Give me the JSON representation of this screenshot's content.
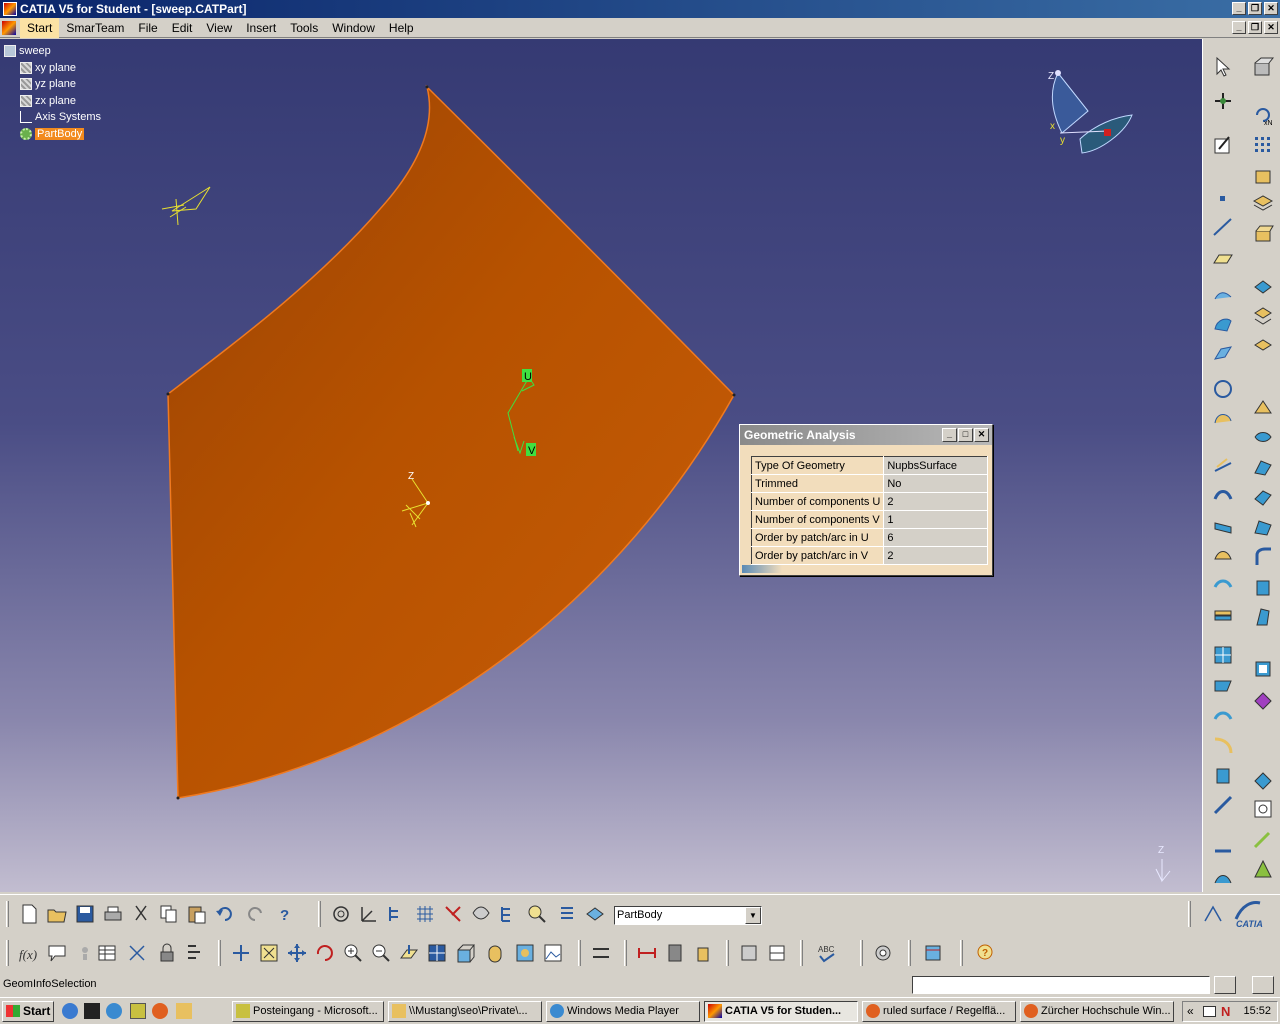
{
  "window": {
    "title": "CATIA V5 for Student - [sweep.CATPart]"
  },
  "menu": [
    "Start",
    "SmarTeam",
    "File",
    "Edit",
    "View",
    "Insert",
    "Tools",
    "Window",
    "Help"
  ],
  "tree": {
    "root": "sweep",
    "items": [
      "xy plane",
      "yz plane",
      "zx plane",
      "Axis Systems",
      "PartBody"
    ]
  },
  "viewport": {
    "axis_labels": {
      "u": "U",
      "v": "V",
      "z": "Z",
      "x": "x",
      "y": "y"
    }
  },
  "dialog": {
    "title": "Geometric Analysis",
    "rows": [
      {
        "label": "Type Of Geometry",
        "value": "NupbsSurface"
      },
      {
        "label": "Trimmed",
        "value": "No"
      },
      {
        "label": "Number of components U",
        "value": "2"
      },
      {
        "label": "Number of components V",
        "value": "1"
      },
      {
        "label": "Order by patch/arc in U",
        "value": "6"
      },
      {
        "label": "Order by patch/arc in V",
        "value": "2"
      }
    ]
  },
  "toolbar": {
    "body_select": "PartBody",
    "fx": "f(x)",
    "abc": "ABC"
  },
  "brand": {
    "logo": "CATIA"
  },
  "status": {
    "text": "GeomInfoSelection"
  },
  "taskbar": {
    "start": "Start",
    "tasks": [
      "Posteingang - Microsoft...",
      "\\\\Mustang\\seo\\Private\\...",
      "Windows Media Player",
      "CATIA V5 for Studen...",
      "ruled surface / Regelflä...",
      "Zürcher Hochschule Win..."
    ],
    "clock": "15:52"
  },
  "colors": {
    "surface": "#c45a08",
    "selection": "#f28a1e",
    "dialog_bg": "#f2ddbc"
  }
}
